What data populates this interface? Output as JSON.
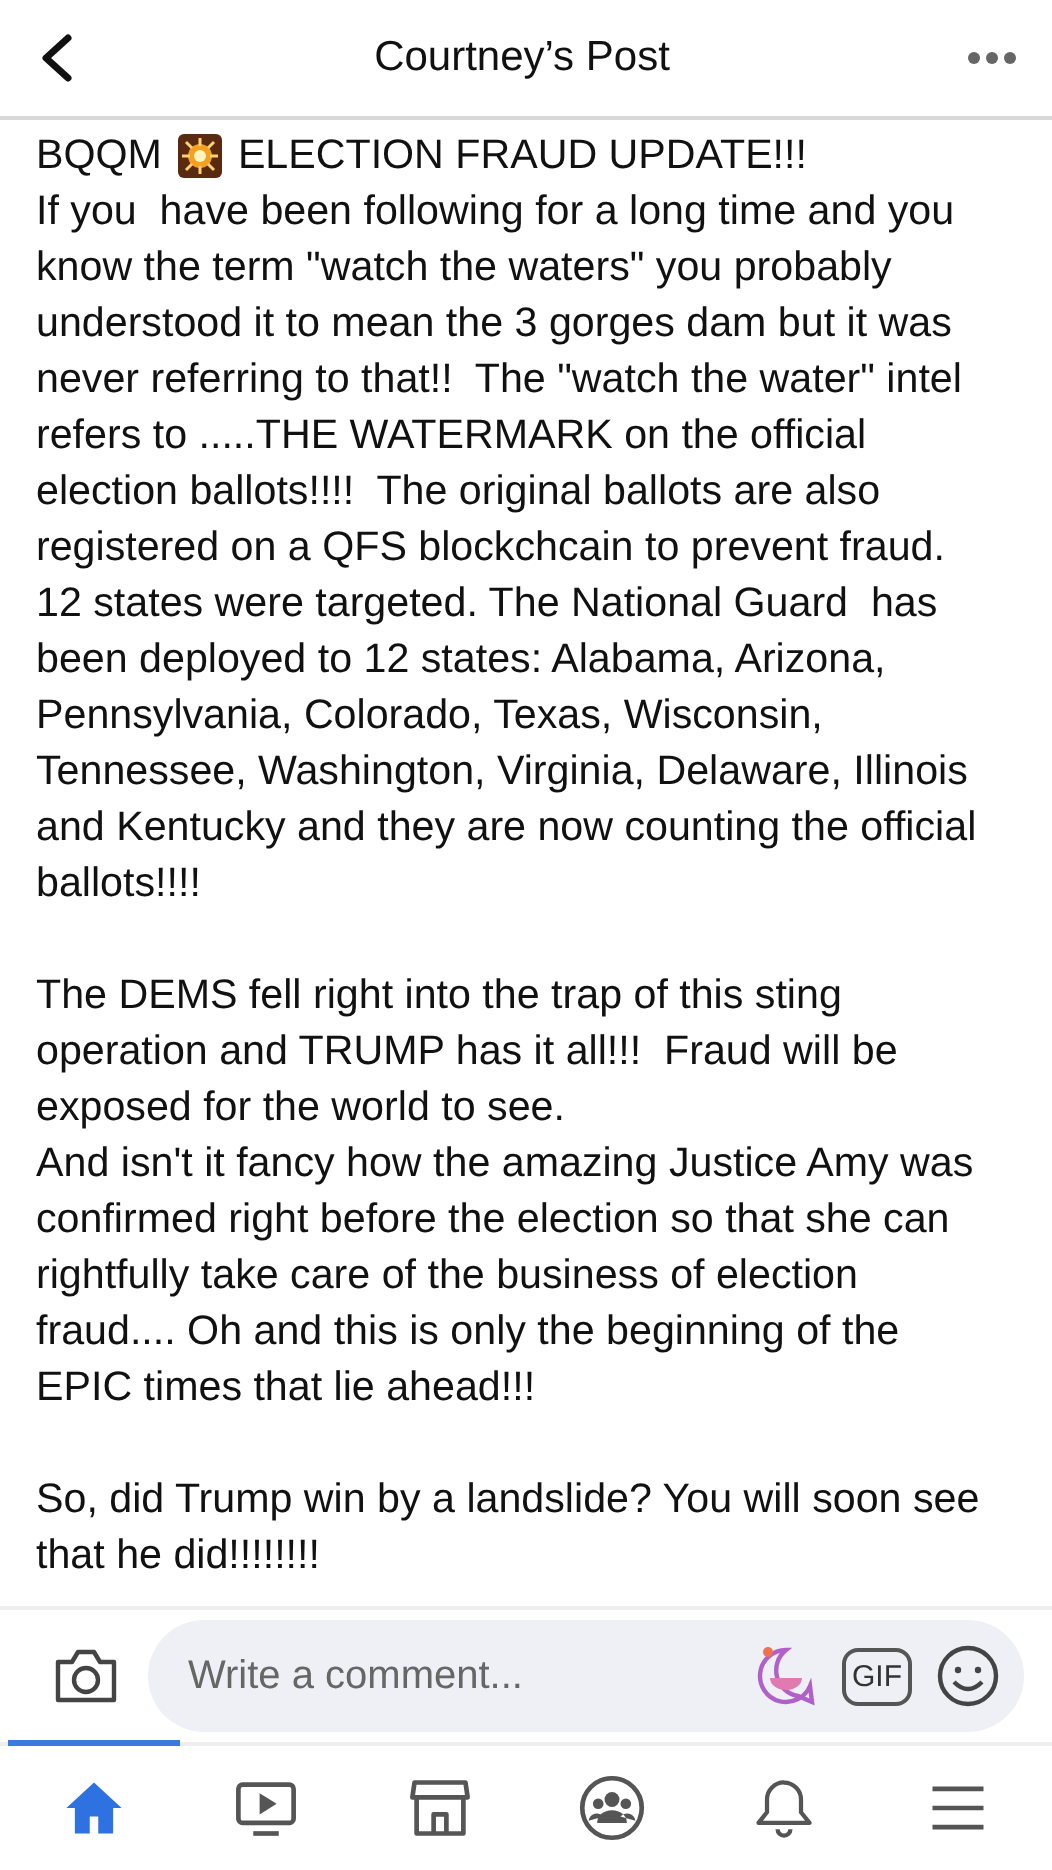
{
  "header": {
    "title": "Courtney’s Post"
  },
  "post": {
    "headline": {
      "before": "BQQM",
      "after": "ELECTION FRAUD UPDATE!!!"
    },
    "blocks": [
      [
        "If you  have been following for a long time and you know the term \"watch the waters\" you probably understood it to mean the 3 gorges dam but it was never referring to that!!  The \"watch the water\" intel refers to .....THE WATERMARK on the official election ballots!!!!  The original ballots are also registered on a QFS blockchcain to prevent fraud. 12 states were targeted. The National Guard  has been deployed to 12 states: Alabama, Arizona, Pennsylvania, Colorado, Texas, Wisconsin, Tennessee, Washington, Virginia, Delaware, Illinois and Kentucky and they are now counting the official ballots!!!!"
      ],
      [
        "The DEMS fell right into the trap of this sting operation and TRUMP has it all!!!  Fraud will be exposed for the world to see.",
        "And isn't it fancy how the amazing Justice Amy was confirmed right before the election so that she can rightfully take care of the business of election fraud.... Oh and this is only the beginning of the EPIC times that lie ahead!!!"
      ],
      [
        "So, did Trump win by a landslide? You will soon see that he did!!!!!!!!"
      ]
    ]
  },
  "comment_bar": {
    "placeholder": "Write a comment...",
    "gif": "GIF"
  },
  "nav": [
    {
      "kind": "home",
      "selected": true
    },
    {
      "kind": "video",
      "selected": false
    },
    {
      "kind": "shop",
      "selected": false
    },
    {
      "kind": "groups",
      "selected": false
    },
    {
      "kind": "bell",
      "selected": false
    },
    {
      "kind": "menu",
      "selected": false
    }
  ]
}
